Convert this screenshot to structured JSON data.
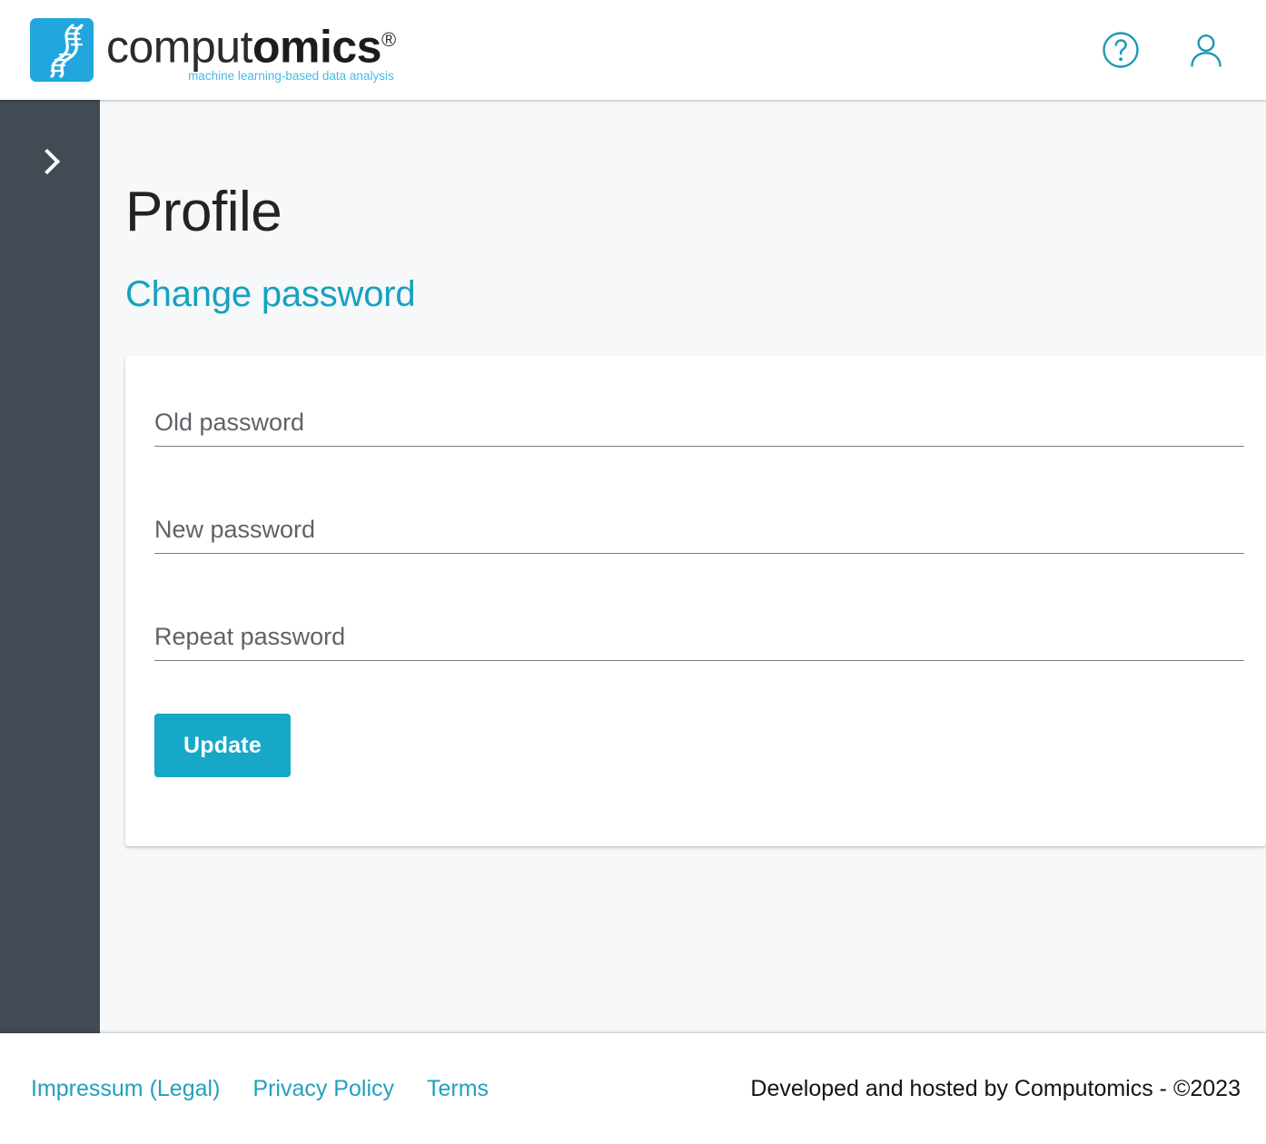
{
  "header": {
    "logo": {
      "mark_icon": "dna-helix-icon",
      "word_part1": "comput",
      "word_part2": "omics",
      "registered_mark": "®",
      "tagline": "machine learning-based data analysis",
      "mark_color": "#21a7dd",
      "tagline_color": "#4bb9e2"
    },
    "actions": [
      {
        "name": "help-icon",
        "label": "Help"
      },
      {
        "name": "user-account-icon",
        "label": "Account"
      }
    ]
  },
  "sidebar": {
    "toggle_icon": "chevron-right-icon",
    "background_color": "#424a54",
    "collapsed": true
  },
  "main": {
    "page_title": "Profile",
    "section_title": "Change password",
    "accent_color": "#16a2c0",
    "form": {
      "fields": [
        {
          "name": "old-password-input",
          "placeholder": "Old password",
          "value": "",
          "type": "password"
        },
        {
          "name": "new-password-input",
          "placeholder": "New password",
          "value": "",
          "type": "password"
        },
        {
          "name": "repeat-password-input",
          "placeholder": "Repeat password",
          "value": "",
          "type": "password"
        }
      ],
      "submit_label": "Update",
      "submit_color": "#18a8c7"
    }
  },
  "footer": {
    "links": [
      "Impressum (Legal)",
      "Privacy Policy",
      "Terms"
    ],
    "note": "Developed and hosted by Computomics - ©2023",
    "link_color": "#23a0bd"
  }
}
